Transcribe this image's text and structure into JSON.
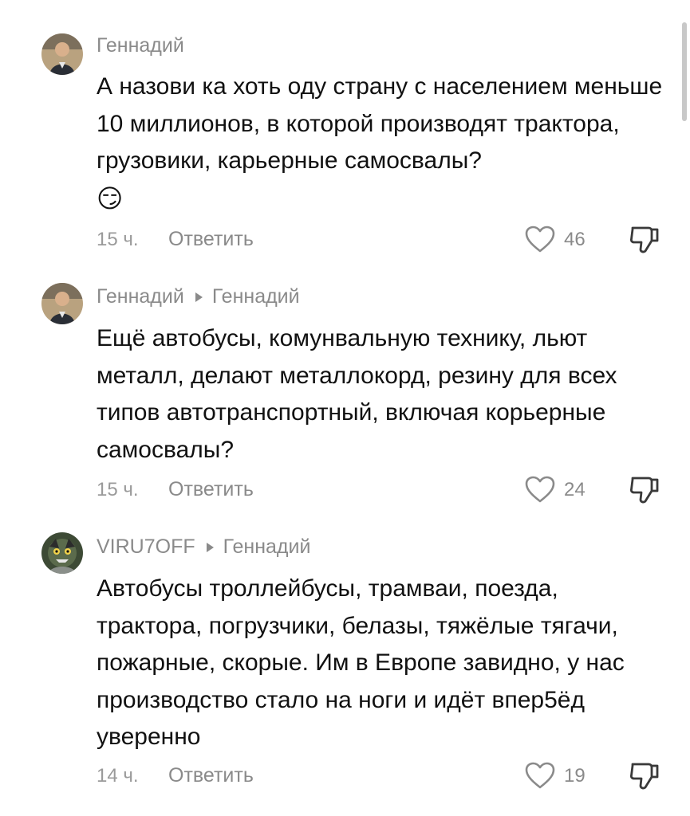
{
  "comments": [
    {
      "author": "Геннадий",
      "reply_to": "",
      "text": "А назови ка хоть оду страну с населением меньше 10 миллионов, в которой производят трактора, грузовики, карьерные самосвалы?",
      "emoji": "😏",
      "time": "15 ч.",
      "reply_label": "Ответить",
      "likes": "46"
    },
    {
      "author": "Геннадий",
      "reply_to": "Геннадий",
      "text": "Ещё автобусы, комунвальную технику, льют металл, делают металлокорд, резину для всех типов автотранспортный, включая корьерные самосвалы?",
      "time": "15 ч.",
      "reply_label": "Ответить",
      "likes": "24"
    },
    {
      "author": "VIRU7OFF",
      "reply_to": "Геннадий",
      "text": "Автобусы троллейбусы, трамваи, поезда, трактора, погрузчики, белазы, тяжёлые тягачи, пожарные, скорые. Им в Европе завидно, у нас производство стало на ноги и идёт впер5ёд уверенно",
      "time": "14 ч.",
      "reply_label": "Ответить",
      "likes": "19"
    }
  ],
  "icons": {
    "like": "heart-outline-icon",
    "dislike": "thumbs-down-icon"
  },
  "colors": {
    "text": "#111111",
    "meta": "#8a8a8a"
  }
}
